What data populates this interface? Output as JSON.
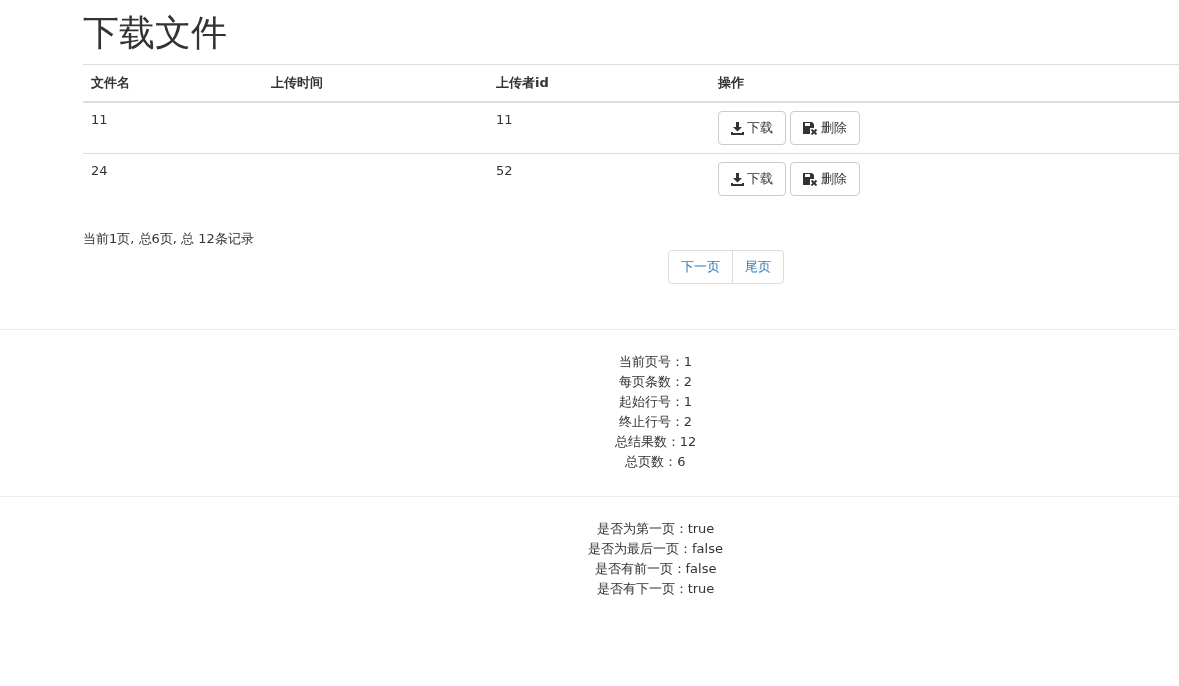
{
  "title": "下载文件",
  "table": {
    "columns": [
      "文件名",
      "上传时间",
      "上传者id",
      "操作"
    ],
    "rows": [
      {
        "cells": [
          "11",
          "",
          "11"
        ],
        "actions": [
          "下载",
          "删除"
        ]
      },
      {
        "cells": [
          "24",
          "",
          "52"
        ],
        "actions": [
          "下载",
          "删除"
        ]
      }
    ]
  },
  "summary": "当前1页, 总6页, 总 12条记录",
  "pagination": [
    "下一页",
    "尾页"
  ],
  "info_groups": [
    [
      "当前页号：1",
      "每页条数：2",
      "起始行号：1",
      "终止行号：2",
      "总结果数：12",
      "总页数：6"
    ],
    [
      "是否为第一页：true",
      "是否为最后一页：false",
      "是否有前一页：false",
      "是否有下一页：true"
    ]
  ]
}
